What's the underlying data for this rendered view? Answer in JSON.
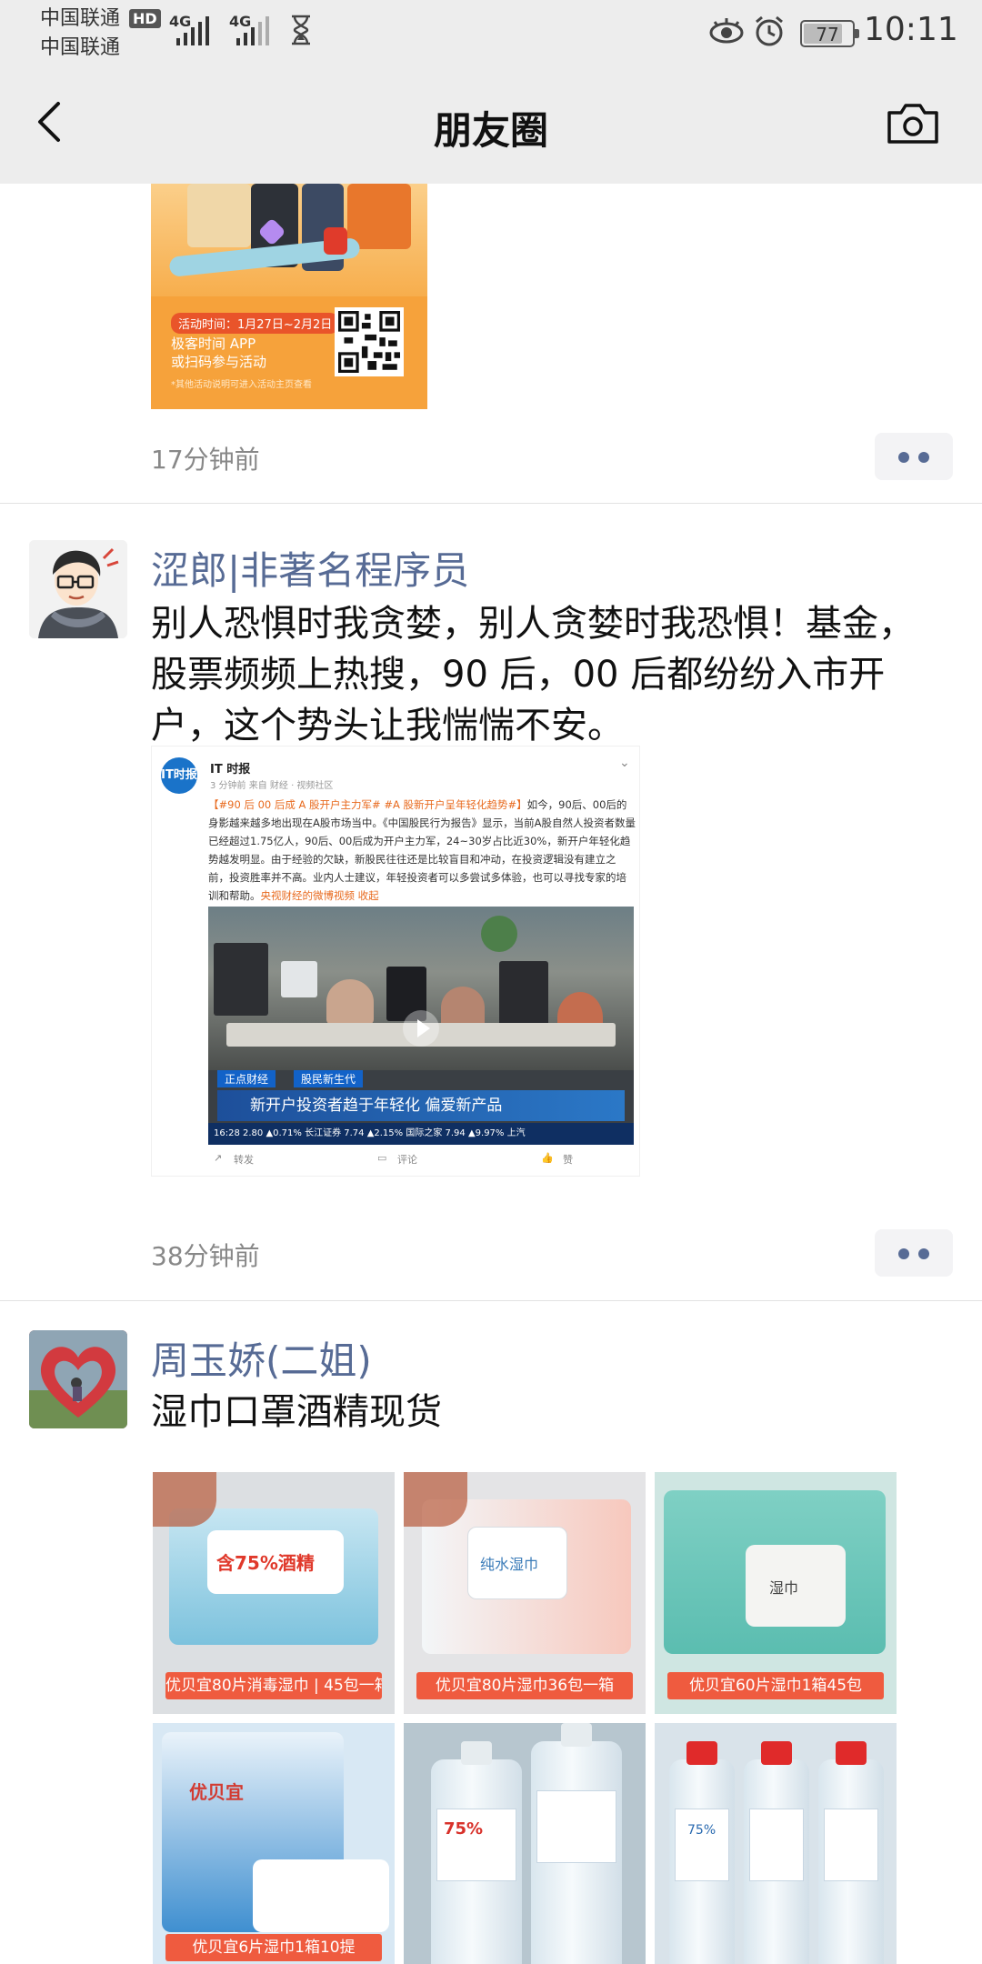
{
  "status_bar": {
    "carrier1": "中国联通",
    "carrier2": "中国联通",
    "hd_badge": "HD",
    "network1": "4G",
    "network2": "4G",
    "battery_level": "77",
    "time": "10:11"
  },
  "nav": {
    "title": "朋友圈",
    "back_icon": "chevron-left-icon",
    "camera_icon": "camera-icon"
  },
  "posts": [
    {
      "promo": {
        "date_range": "活动时间：1月27日~2月2日",
        "line1": "极客时间 APP",
        "line2": "或扫码参与活动",
        "note": "*其他活动说明可进入活动主页查看"
      },
      "time": "17分钟前"
    },
    {
      "nickname": "涩郎|非著名程序员",
      "text": "别人恐惧时我贪婪，别人贪婪时我恐惧！基金，股票频频上热搜，90 后，00 后都纷纷入市开户，这个势头让我惴惴不安。",
      "card": {
        "logo_text": "IT时报",
        "source_name": "IT 时报",
        "meta": "3 分钟前 来自 财经 · 视频社区",
        "body_highlight": "【#90 后 00 后成 A 股开户主力军# #A 股新开户呈年轻化趋势#】",
        "body": "如今，90后、00后的身影越来越多地出现在A股市场当中。《中国股民行为报告》显示，当前A股自然人投资者数量已经超过1.75亿人，90后、00后成为开户主力军，24~30岁占比近30%，新开户年轻化趋势越发明显。由于经验的欠缺，新股民往往还是比较盲目和冲动，在投资逻辑没有建立之前，投资胜率并不高。业内人士建议，年轻投资者可以多尝试多体验，也可以寻找专家的培训和帮助。",
        "body_link": "央视财经的微博视频 收起",
        "video_tag1": "正点财经",
        "video_tag2": "股民新生代",
        "video_headline": "新开户投资者趋于年轻化 偏爱新产品",
        "video_ticker": "16:28  2.80  ▲0.71%  长江证券  7.74  ▲2.15%  国际之家  7.94  ▲9.97%  上汽",
        "action_forward": "转发",
        "action_comment": "评论",
        "action_like": "赞"
      },
      "time": "38分钟前"
    },
    {
      "nickname": "周玉娇(二姐)",
      "text": "湿巾口罩酒精现货",
      "photos": [
        {
          "label": "优贝宜80片消毒湿巾 | 45包一箱",
          "pack_text": "含75%酒精"
        },
        {
          "label": "优贝宜80片湿巾36包一箱",
          "pack_text": "纯水湿巾"
        },
        {
          "label": "优贝宜60片湿巾1箱45包",
          "pack_text": "湿巾"
        },
        {
          "label": "优贝宜6片湿巾1箱10提",
          "pack_text": "优贝宜"
        },
        {
          "label": "",
          "pack_text": "75%"
        },
        {
          "label": "",
          "pack_text": "75%"
        }
      ]
    }
  ],
  "colors": {
    "nickname": "#576b95",
    "bar_bg": "#ededed",
    "promo_orange": "#f6a23b"
  }
}
